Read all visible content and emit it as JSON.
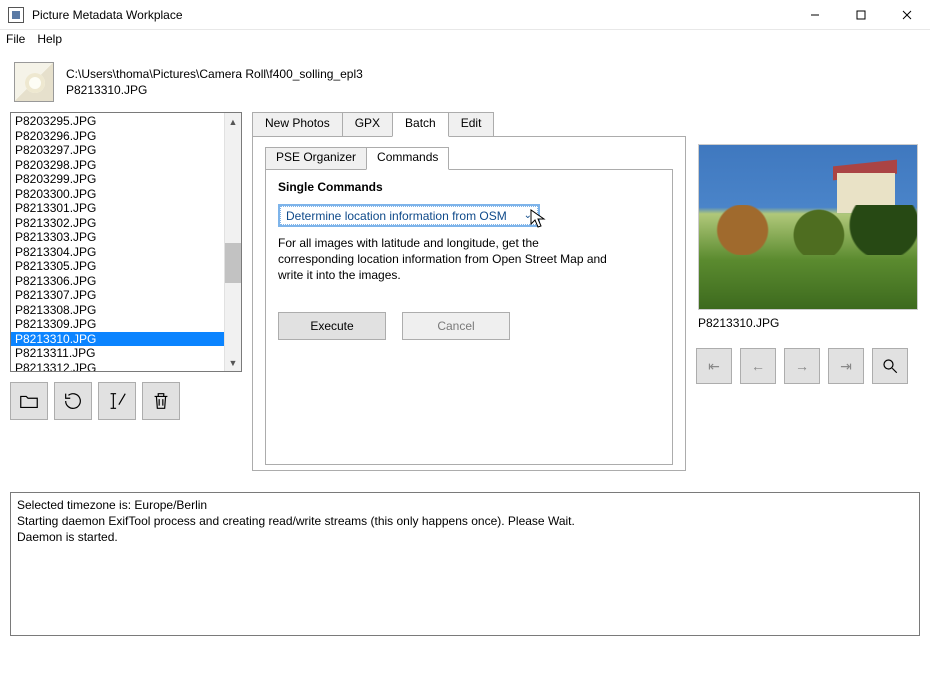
{
  "window": {
    "title": "Picture Metadata Workplace"
  },
  "menu": {
    "file": "File",
    "help": "Help"
  },
  "header": {
    "dir": "C:\\Users\\thoma\\Pictures\\Camera Roll\\f400_solling_epl3",
    "file": "P8213310.JPG"
  },
  "fileList": {
    "selectedIndex": 15,
    "items": [
      "P8203295.JPG",
      "P8203296.JPG",
      "P8203297.JPG",
      "P8203298.JPG",
      "P8203299.JPG",
      "P8203300.JPG",
      "P8213301.JPG",
      "P8213302.JPG",
      "P8213303.JPG",
      "P8213304.JPG",
      "P8213305.JPG",
      "P8213306.JPG",
      "P8213307.JPG",
      "P8213308.JPG",
      "P8213309.JPG",
      "P8213310.JPG",
      "P8213311.JPG",
      "P8213312.JPG"
    ]
  },
  "tabs": {
    "main": [
      "New Photos",
      "GPX",
      "Batch",
      "Edit"
    ],
    "mainActiveIndex": 2,
    "sub": [
      "PSE Organizer",
      "Commands"
    ],
    "subActiveIndex": 1
  },
  "commands": {
    "sectionTitle": "Single Commands",
    "dropdownValue": "Determine location information from OSM",
    "description": "For all images with latitude and longitude, get the corresponding location information from Open Street Map and write it into the images.",
    "executeLabel": "Execute",
    "cancelLabel": "Cancel"
  },
  "preview": {
    "caption": "P8213310.JPG"
  },
  "nav": {
    "first": "←",
    "prev": "←",
    "next": "→",
    "last": "→"
  },
  "log": {
    "lines": [
      "Selected timezone is: Europe/Berlin",
      "Starting daemon ExifTool process and creating read/write streams (this only happens once). Please Wait.",
      "Daemon is started."
    ]
  }
}
